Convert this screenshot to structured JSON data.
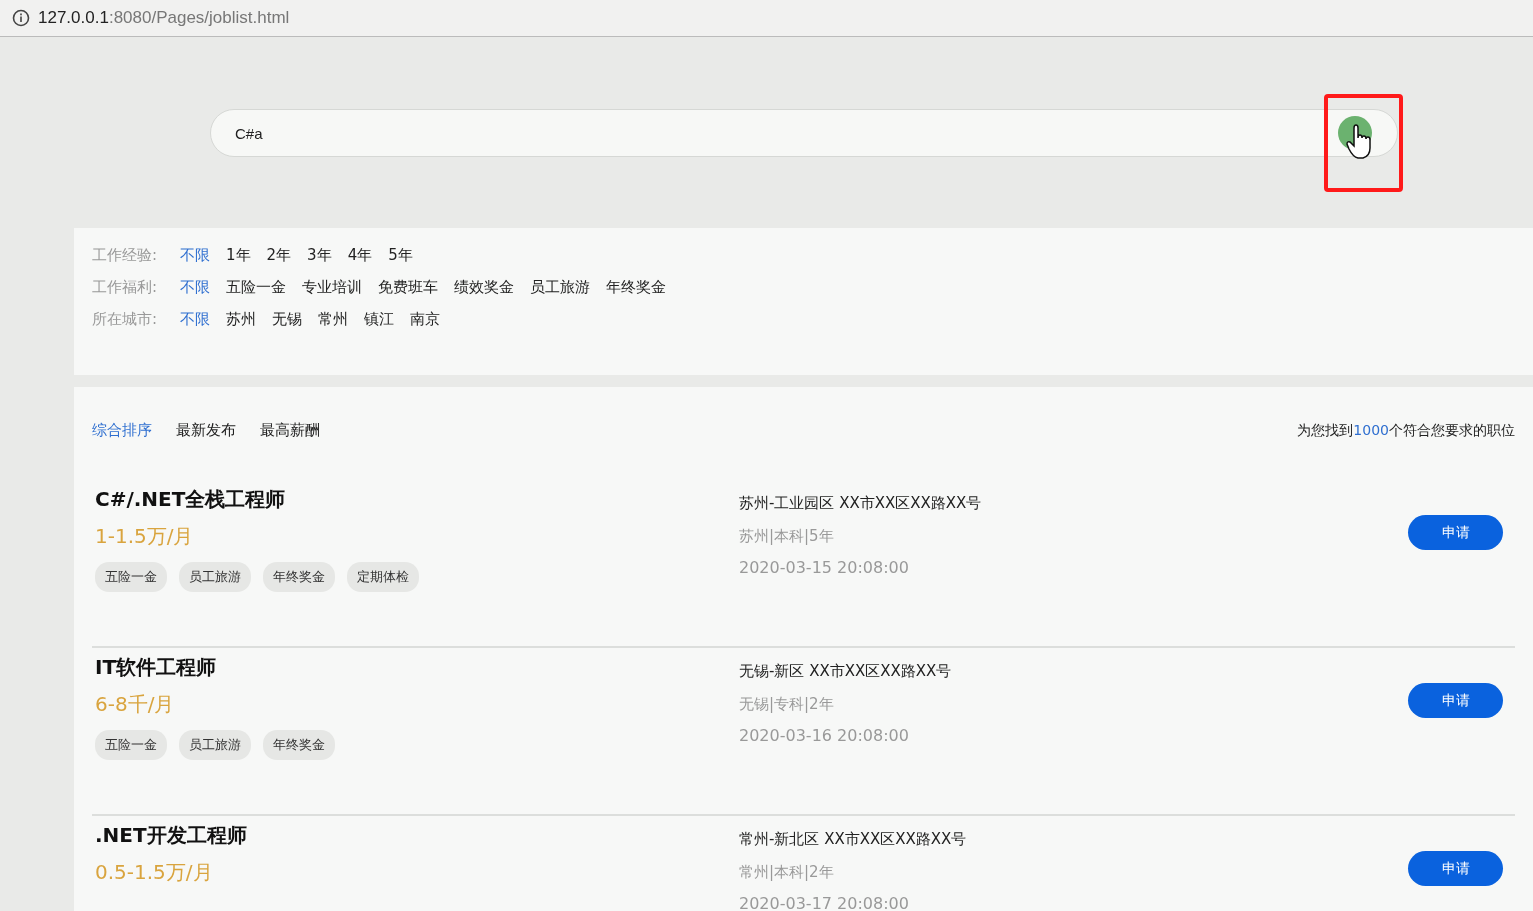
{
  "address_bar": {
    "url_host": "127.0.0.1",
    "url_rest": ":8080/Pages/joblist.html"
  },
  "search": {
    "value": "C#a"
  },
  "filters": [
    {
      "label": "工作经验:",
      "options": [
        {
          "label": "不限",
          "selected": true
        },
        {
          "label": "1年",
          "selected": false
        },
        {
          "label": "2年",
          "selected": false
        },
        {
          "label": "3年",
          "selected": false
        },
        {
          "label": "4年",
          "selected": false
        },
        {
          "label": "5年",
          "selected": false
        }
      ]
    },
    {
      "label": "工作福利:",
      "options": [
        {
          "label": "不限",
          "selected": true
        },
        {
          "label": "五险一金",
          "selected": false
        },
        {
          "label": "专业培训",
          "selected": false
        },
        {
          "label": "免费班车",
          "selected": false
        },
        {
          "label": "绩效奖金",
          "selected": false
        },
        {
          "label": "员工旅游",
          "selected": false
        },
        {
          "label": "年终奖金",
          "selected": false
        }
      ]
    },
    {
      "label": "所在城市:",
      "options": [
        {
          "label": "不限",
          "selected": true
        },
        {
          "label": "苏州",
          "selected": false
        },
        {
          "label": "无锡",
          "selected": false
        },
        {
          "label": "常州",
          "selected": false
        },
        {
          "label": "镇江",
          "selected": false
        },
        {
          "label": "南京",
          "selected": false
        }
      ]
    }
  ],
  "sort_tabs": [
    {
      "label": "综合排序",
      "selected": true
    },
    {
      "label": "最新发布",
      "selected": false
    },
    {
      "label": "最高薪酬",
      "selected": false
    }
  ],
  "result_count": {
    "before": "为您找到",
    "count": "1000",
    "after": "个符合您要求的职位"
  },
  "jobs": [
    {
      "title": "C#/.NET全栈工程师",
      "salary": "1-1.5万/月",
      "tags": [
        "五险一金",
        "员工旅游",
        "年终奖金",
        "定期体检"
      ],
      "address": "苏州-工业园区 XX市XX区XX路XX号",
      "requirements": "苏州|本科|5年",
      "date": "2020-03-15 20:08:00",
      "apply": "申请"
    },
    {
      "title": "IT软件工程师",
      "salary": "6-8千/月",
      "tags": [
        "五险一金",
        "员工旅游",
        "年终奖金"
      ],
      "address": "无锡-新区 XX市XX区XX路XX号",
      "requirements": "无锡|专科|2年",
      "date": "2020-03-16 20:08:00",
      "apply": "申请"
    },
    {
      "title": ".NET开发工程师",
      "salary": "0.5-1.5万/月",
      "address": "常州-新北区 XX市XX区XX路XX号",
      "requirements": "常州|本科|2年",
      "date": "2020-03-17 20:08:00",
      "apply": "申请"
    }
  ]
}
